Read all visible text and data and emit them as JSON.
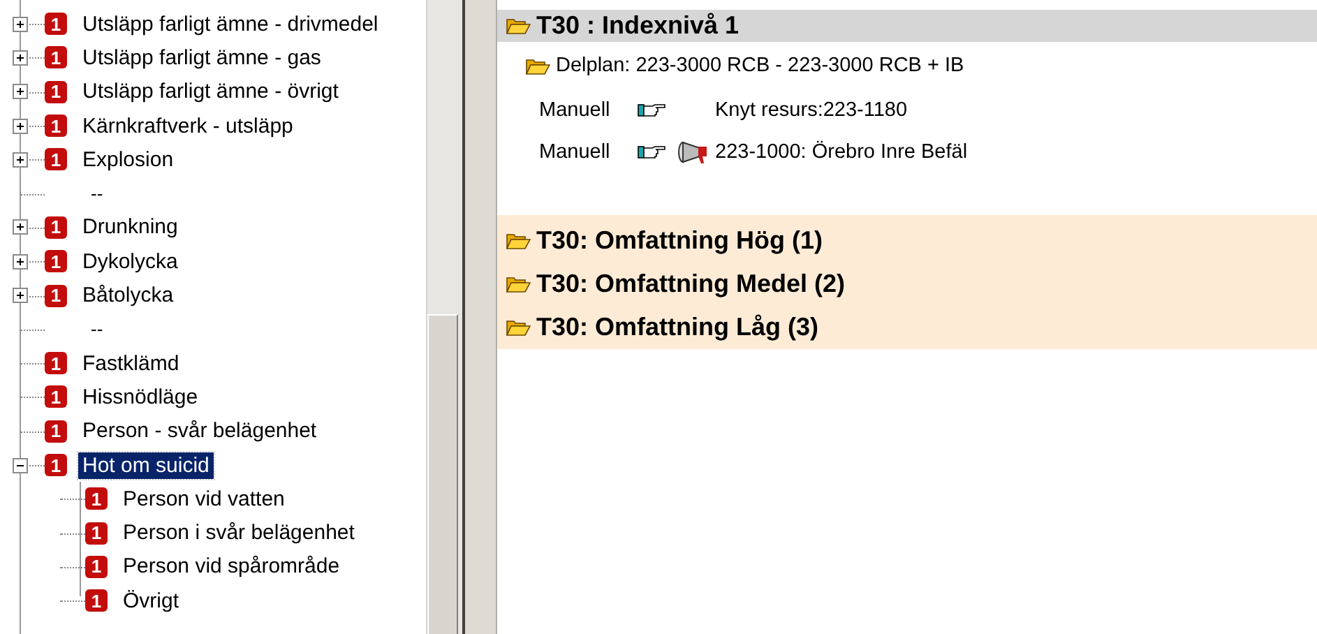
{
  "tree": [
    {
      "kind": "group",
      "label": "Utsläpp farligt ämne - drivmedel",
      "badge": "1",
      "expanded": false,
      "selected": false
    },
    {
      "kind": "group",
      "label": "Utsläpp farligt ämne - gas",
      "badge": "1",
      "expanded": false,
      "selected": false
    },
    {
      "kind": "group",
      "label": "Utsläpp farligt ämne - övrigt",
      "badge": "1",
      "expanded": false,
      "selected": false
    },
    {
      "kind": "group",
      "label": "Kärnkraftverk - utsläpp",
      "badge": "1",
      "expanded": false,
      "selected": false
    },
    {
      "kind": "group",
      "label": "Explosion",
      "badge": "1",
      "expanded": false,
      "selected": false
    },
    {
      "kind": "separator",
      "label": "--"
    },
    {
      "kind": "group",
      "label": "Drunkning",
      "badge": "1",
      "expanded": false,
      "selected": false
    },
    {
      "kind": "group",
      "label": "Dykolycka",
      "badge": "1",
      "expanded": false,
      "selected": false
    },
    {
      "kind": "group",
      "label": "Båtolycka",
      "badge": "1",
      "expanded": false,
      "selected": false
    },
    {
      "kind": "separator",
      "label": "--"
    },
    {
      "kind": "leaf",
      "label": "Fastklämd",
      "badge": "1",
      "selected": false
    },
    {
      "kind": "leaf",
      "label": "Hissnödläge",
      "badge": "1",
      "selected": false
    },
    {
      "kind": "leaf",
      "label": "Person - svår belägenhet",
      "badge": "1",
      "selected": false
    },
    {
      "kind": "group",
      "label": "Hot om suicid",
      "badge": "1",
      "expanded": true,
      "selected": true,
      "children": [
        {
          "kind": "leaf",
          "label": "Person vid vatten",
          "badge": "1",
          "selected": false
        },
        {
          "kind": "leaf",
          "label": "Person i svår belägenhet",
          "badge": "1",
          "selected": false
        },
        {
          "kind": "leaf",
          "label": "Person vid spårområde",
          "badge": "1",
          "selected": false
        },
        {
          "kind": "leaf",
          "label": "Övrigt",
          "badge": "1",
          "selected": false
        }
      ]
    }
  ],
  "levels": [
    {
      "title": "T30 : Indexnivå 1",
      "selected": true,
      "delplan": "Delplan: 223-3000 RCB - 223-3000 RCB + IB",
      "actions": [
        {
          "kind": "resource",
          "mode": "Manuell",
          "text": "Knyt resurs:223-1180"
        },
        {
          "kind": "alarm",
          "mode": "Manuell",
          "text": "223-1000: Örebro Inre Befäl"
        }
      ]
    },
    {
      "title": "T30: Omfattning Hög (1)",
      "selected": false
    },
    {
      "title": "T30: Omfattning Medel (2)",
      "selected": false
    },
    {
      "title": "T30: Omfattning Låg (3)",
      "selected": false
    }
  ]
}
